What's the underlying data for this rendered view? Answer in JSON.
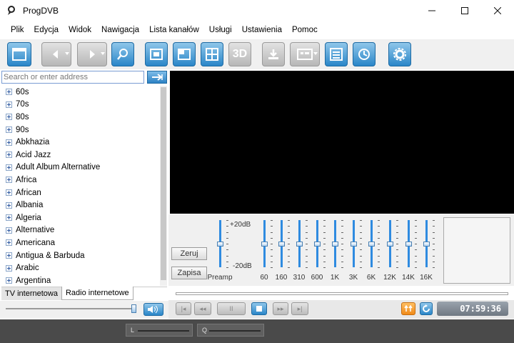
{
  "window": {
    "title": "ProgDVB",
    "icons": {
      "app": "progdvb-logo-icon",
      "minimize": "minimize-icon",
      "maximize": "maximize-icon",
      "close": "close-icon"
    }
  },
  "menu": [
    "Plik",
    "Edycja",
    "Widok",
    "Nawigacja",
    "Lista kanałów",
    "Usługi",
    "Ustawienia",
    "Pomoc"
  ],
  "toolbar": {
    "buttons": [
      {
        "icon": "window-icon",
        "enabled": true
      },
      {
        "icon": "back-icon",
        "enabled": false,
        "dropdown": true
      },
      {
        "icon": "forward-icon",
        "enabled": false,
        "dropdown": true
      },
      {
        "icon": "search-icon",
        "enabled": true
      },
      {
        "icon": "window-mode-icon",
        "enabled": true
      },
      {
        "icon": "fullscreen-icon",
        "enabled": true
      },
      {
        "icon": "grid-icon",
        "enabled": true
      },
      {
        "icon": "3d-icon",
        "label": "3D",
        "enabled": false
      },
      {
        "icon": "record-icon",
        "enabled": false
      },
      {
        "icon": "teletext-icon",
        "enabled": false,
        "dropdown": true
      },
      {
        "icon": "epg-list-icon",
        "enabled": true
      },
      {
        "icon": "scheduler-icon",
        "enabled": true
      },
      {
        "icon": "settings-icon",
        "enabled": true
      }
    ]
  },
  "search": {
    "placeholder": "Search or enter address",
    "go_icon": "go-arrow-icon"
  },
  "channel_tree": {
    "items": [
      "60s",
      "70s",
      "80s",
      "90s",
      "Abkhazia",
      "Acid Jazz",
      "Adult Album Alternative",
      "Africa",
      "African",
      "Albania",
      "Algeria",
      "Alternative",
      "Americana",
      "Antigua & Barbuda",
      "Arabic",
      "Argentina"
    ]
  },
  "tabs": {
    "tv": "TV internetowa",
    "radio": "Radio internetowe",
    "active": "radio"
  },
  "volume": {
    "level": 0.98,
    "icon": "speaker-icon"
  },
  "equalizer": {
    "reset_label": "Zeruj",
    "save_label": "Zapisa",
    "db_max": "+20dB",
    "db_min": "-20dB",
    "preamp_label": "Preamp",
    "bands": [
      "60",
      "160",
      "310",
      "600",
      "1K",
      "3K",
      "6K",
      "12K",
      "14K",
      "16K"
    ],
    "levels": [
      0,
      0,
      0,
      0,
      0,
      0,
      0,
      0,
      0,
      0
    ],
    "preamp_level": 0
  },
  "playback": {
    "buttons": [
      "prev-track-icon",
      "rewind-icon",
      "pause-icon",
      "stop-icon",
      "fast-forward-icon",
      "next-track-icon"
    ],
    "time": "07:59:36",
    "icons": {
      "audio": "audio-channel-icon",
      "refresh": "refresh-icon"
    }
  },
  "statusbar": {
    "left_label": "L",
    "right_label": "Q"
  },
  "colors": {
    "accent_blue": "#2a86c8",
    "video_bg": "#000000",
    "eq_slider": "#2f8be0",
    "status_bg": "#4a4a4a"
  }
}
